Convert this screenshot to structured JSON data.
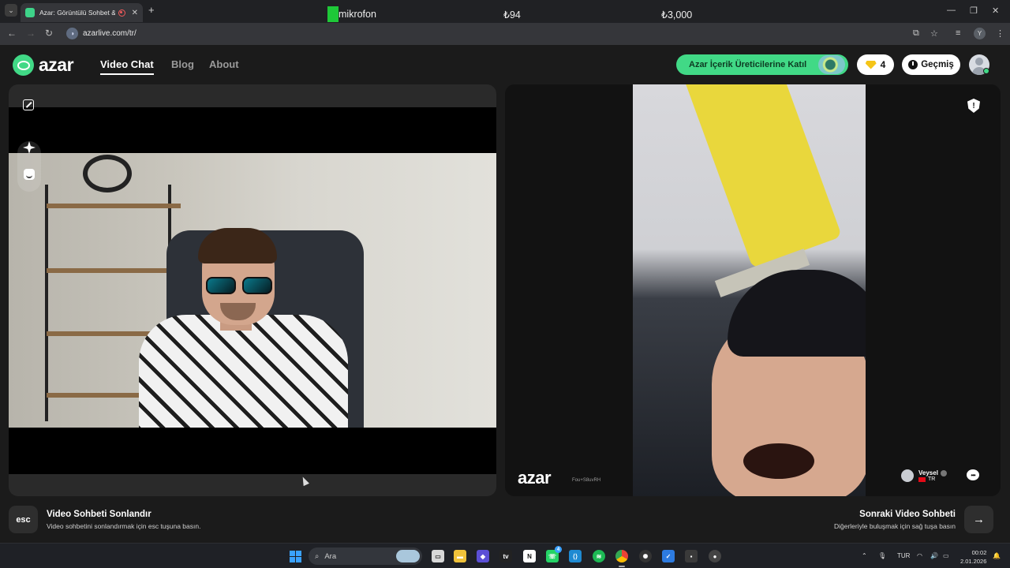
{
  "browser": {
    "tab_title": "Azar: Görüntülü Sohbet & V",
    "url": "azarlive.com/tr/",
    "profile_initial": "Y"
  },
  "overlay": {
    "mic_label": "mikrofon",
    "value_1": "₺94",
    "value_2": "₺3,000"
  },
  "site": {
    "logo_text": "azar",
    "nav": [
      "Video Chat",
      "Blog",
      "About"
    ],
    "creator_cta": "Azar İçerik Üreticilerine Katıl",
    "gem_count": "4",
    "history_label": "Geçmiş"
  },
  "partner": {
    "watermark": "azar",
    "watermark_id": "Fou+S8uvRH",
    "name": "Veysel",
    "country": "TR"
  },
  "controls": {
    "esc_key": "esc",
    "end_title": "Video Sohbeti Sonlandır",
    "end_desc": "Video sohbetini sonlandırmak için esc tuşuna basın.",
    "next_title": "Sonraki Video Sohbeti",
    "next_desc": "Diğerleriyle buluşmak için sağ tuşa basın"
  },
  "taskbar": {
    "search_placeholder": "Ara",
    "whatsapp_badge": "4",
    "language": "TUR",
    "time": "00:02",
    "date": "2.01.2026"
  },
  "colors": {
    "brand_green": "#41d986",
    "background": "#1b1b1b"
  }
}
